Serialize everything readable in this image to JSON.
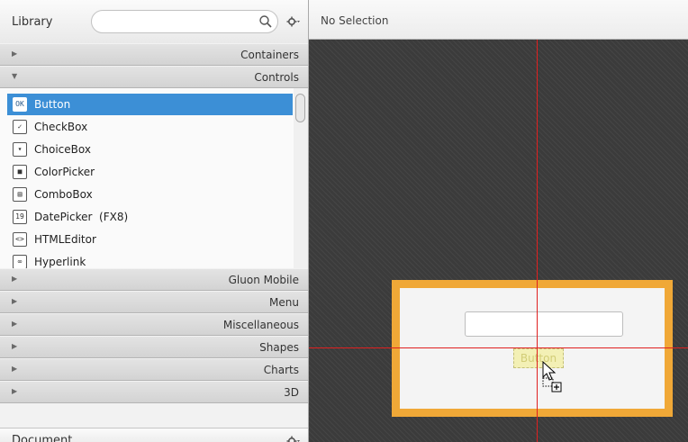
{
  "library": {
    "title": "Library",
    "search": {
      "placeholder": ""
    },
    "sections_top": [
      {
        "label": "Containers",
        "expanded": false
      },
      {
        "label": "Controls",
        "expanded": true
      }
    ],
    "controls": [
      {
        "label": "Button",
        "icon": "OK",
        "selected": true
      },
      {
        "label": "CheckBox",
        "icon": "✓"
      },
      {
        "label": "ChoiceBox",
        "icon": "▾"
      },
      {
        "label": "ColorPicker",
        "icon": "■"
      },
      {
        "label": "ComboBox",
        "icon": "▤"
      },
      {
        "label": "DatePicker  (FX8)",
        "icon": "19"
      },
      {
        "label": "HTMLEditor",
        "icon": "<>"
      },
      {
        "label": "Hyperlink",
        "icon": "∞"
      }
    ],
    "sections_bottom": [
      {
        "label": "Gluon Mobile"
      },
      {
        "label": "Menu"
      },
      {
        "label": "Miscellaneous"
      },
      {
        "label": "Shapes"
      },
      {
        "label": "Charts"
      },
      {
        "label": "3D"
      }
    ]
  },
  "document": {
    "title": "Document"
  },
  "selection_bar": {
    "text": "No Selection"
  },
  "canvas": {
    "dragged_control_label": "Button",
    "colors": {
      "artboard_border": "#f0a837",
      "guide": "#e02020",
      "selection": "#3c8fd6"
    }
  }
}
